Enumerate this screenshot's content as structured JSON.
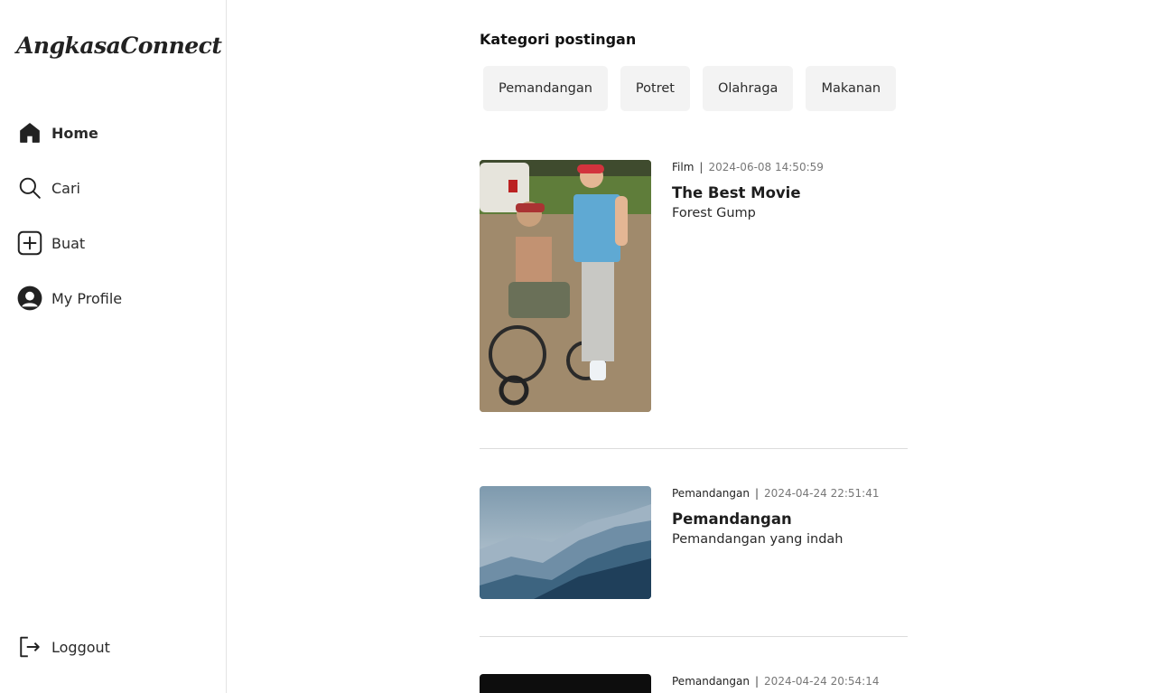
{
  "app": {
    "logo": "AngkasaConnect"
  },
  "sidebar": {
    "items": [
      {
        "label": "Home",
        "icon": "home-icon"
      },
      {
        "label": "Cari",
        "icon": "search-icon"
      },
      {
        "label": "Buat",
        "icon": "plus-square-icon"
      },
      {
        "label": "My Profile",
        "icon": "profile-icon"
      }
    ],
    "logout": {
      "label": "Loggout",
      "icon": "logout-icon"
    }
  },
  "categories": {
    "title": "Kategori postingan",
    "items": [
      "Pemandangan",
      "Potret",
      "Olahraga",
      "Makanan"
    ]
  },
  "posts": [
    {
      "category": "Film",
      "timestamp": "2024-06-08 14:50:59",
      "title": "The Best Movie",
      "description": "Forest Gump"
    },
    {
      "category": "Pemandangan",
      "timestamp": "2024-04-24 22:51:41",
      "title": "Pemandangan",
      "description": "Pemandangan yang indah"
    },
    {
      "category": "Pemandangan",
      "timestamp": "2024-04-24 20:54:14"
    }
  ],
  "colors": {
    "accent": "#222222",
    "chip_bg": "#f3f3f3",
    "divider": "#dcdcdc"
  }
}
